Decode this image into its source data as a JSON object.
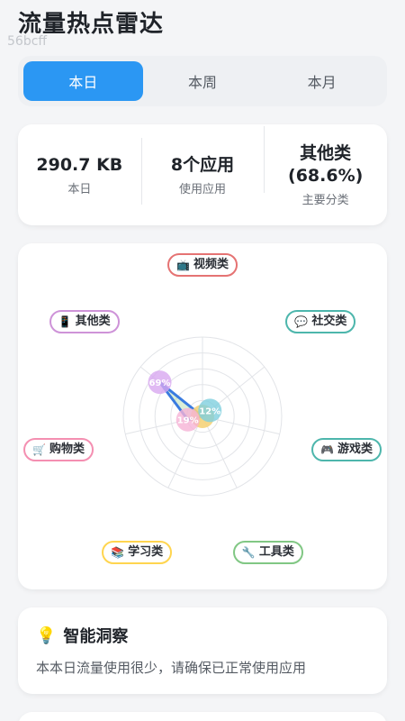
{
  "header": {
    "title": "流量热点雷达",
    "watermark": "56bcff"
  },
  "period_tabs": [
    {
      "label": "本日",
      "active": true
    },
    {
      "label": "本周",
      "active": false
    },
    {
      "label": "本月",
      "active": false
    }
  ],
  "stats": [
    {
      "value": "290.7 KB",
      "label": "本日"
    },
    {
      "value": "8个应用",
      "label": "使用应用"
    },
    {
      "value_line1": "其他类",
      "value_line2": "(68.6%)",
      "label": "主要分类"
    }
  ],
  "radar": {
    "categories": [
      {
        "name": "视频类",
        "icon": "tv-icon",
        "glyph": "📺",
        "color": "#e57373"
      },
      {
        "name": "社交类",
        "icon": "speech-bubble-icon",
        "glyph": "💬",
        "color": "#4db6ac"
      },
      {
        "name": "游戏类",
        "icon": "gamepad-icon",
        "glyph": "🎮",
        "color": "#4db6ac"
      },
      {
        "name": "工具类",
        "icon": "wrench-icon",
        "glyph": "🔧",
        "color": "#81c784"
      },
      {
        "name": "学习类",
        "icon": "books-icon",
        "glyph": "📚",
        "color": "#ffd54f"
      },
      {
        "name": "购物类",
        "icon": "cart-icon",
        "glyph": "🛒",
        "color": "#f48fb1"
      },
      {
        "name": "其他类",
        "icon": "phone-icon",
        "glyph": "📱",
        "color": "#ce93d8"
      }
    ],
    "points": [
      {
        "category": "其他类",
        "percent": 69,
        "label": "69%",
        "color": "#d8a8f0"
      },
      {
        "category": "购物类",
        "percent": 19,
        "label": "19%",
        "color": "#f6b3d6"
      },
      {
        "category": "社交类",
        "percent": 12,
        "label": "12%",
        "color": "#7fd0de"
      }
    ],
    "polygon_color": "#3a7be0"
  },
  "insight": {
    "icon": "lightbulb-icon",
    "title": "智能洞察",
    "text": "本本日流量使用很少，请确保已正常使用应用"
  }
}
